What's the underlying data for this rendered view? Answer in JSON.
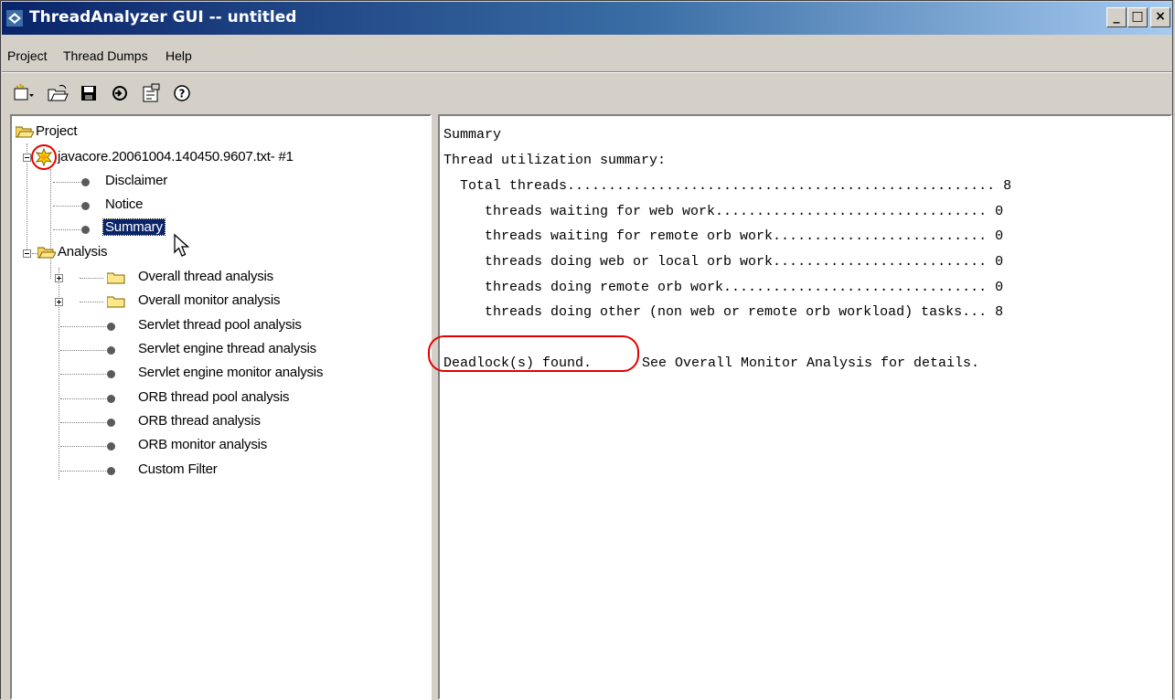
{
  "window": {
    "title": "ThreadAnalyzer GUI -- untitled",
    "controls": {
      "minimize": "_",
      "maximize": "□",
      "close": "×"
    }
  },
  "menu": [
    "Project",
    "Thread Dumps",
    "Help"
  ],
  "toolbar": {
    "icons": [
      "new-project-icon",
      "open-icon",
      "save-icon",
      "refresh-icon",
      "properties-icon",
      "help-icon"
    ]
  },
  "tree": {
    "root": "Project",
    "file": "javacore.20061004.140450.9607.txt- #1",
    "file_children": [
      "Disclaimer",
      "Notice",
      "Summary"
    ],
    "analysis": "Analysis",
    "analysis_folders": [
      "Overall thread analysis",
      "Overall monitor analysis"
    ],
    "analysis_items": [
      "Servlet thread pool analysis",
      "Servlet engine thread analysis",
      "Servlet engine monitor analysis",
      "ORB thread pool analysis",
      "ORB thread analysis",
      "ORB monitor analysis",
      "Custom Filter"
    ],
    "selected": "Summary"
  },
  "report": {
    "heading": "Summary",
    "subheading": "Thread utilization summary:",
    "lines": [
      "  Total threads.................................................... 8",
      "     threads waiting for web work................................. 0",
      "     threads waiting for remote orb work.......................... 0",
      "     threads doing web or local orb work.......................... 0",
      "     threads doing remote orb work................................ 0",
      "     threads doing other (non web or remote orb workload) tasks... 8"
    ],
    "deadlock": "Deadlock(s) found.",
    "deadlock_detail": "  See Overall Monitor Analysis for details."
  },
  "colors": {
    "title_start": "#0a246a",
    "title_end": "#a6caf0",
    "highlight": "#e30000",
    "selection": "#0a246a"
  }
}
